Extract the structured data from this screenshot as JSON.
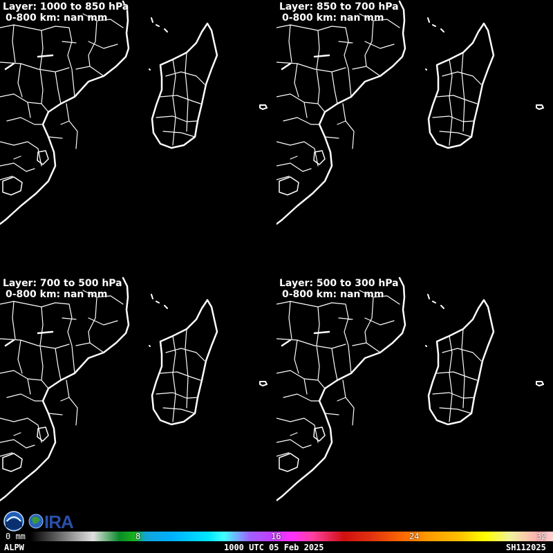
{
  "panels": [
    {
      "layer": "Layer: 1000 to 850 hPa",
      "stat": "0-800 km: nan mm"
    },
    {
      "layer": "Layer: 850 to 700 hPa",
      "stat": "0-800 km: nan mm"
    },
    {
      "layer": "Layer: 700 to 500 hPa",
      "stat": "0-800 km: nan mm"
    },
    {
      "layer": "Layer: 500 to 300 hPa",
      "stat": "0-800 km: nan mm"
    }
  ],
  "colorbar": {
    "ticks": [
      "0 mm",
      "8",
      "16",
      "24",
      "32"
    ]
  },
  "footer": {
    "product": "ALPW",
    "time": "1000 UTC 05 Feb 2025",
    "storm": "SH112025"
  },
  "logos": {
    "noaa": "NOAA",
    "cira": "CIRA"
  },
  "colors": {
    "background": "#000000",
    "coastline": "#ffffff"
  }
}
